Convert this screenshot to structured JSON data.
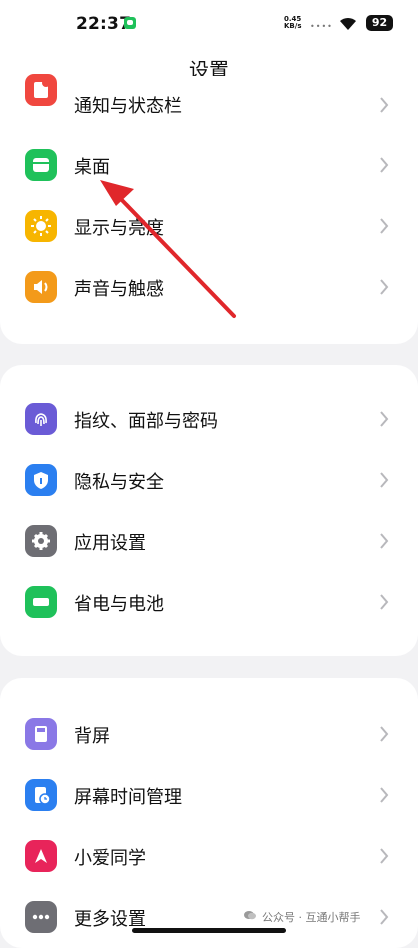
{
  "status_bar": {
    "time": "22:37",
    "speed_value": "0.45",
    "speed_unit": "KB/s",
    "battery": "92"
  },
  "header": {
    "title": "设置"
  },
  "sections": [
    {
      "items": [
        {
          "label": "通知与状态栏",
          "icon": "notification-icon",
          "color": "#f0473f"
        },
        {
          "label": "桌面",
          "icon": "desktop-icon",
          "color": "#1fc15a"
        },
        {
          "label": "显示与亮度",
          "icon": "sun-icon",
          "color": "#f7b500"
        },
        {
          "label": "声音与触感",
          "icon": "speaker-icon",
          "color": "#f39a1a"
        }
      ]
    },
    {
      "items": [
        {
          "label": "指纹、面部与密码",
          "icon": "fingerprint-icon",
          "color": "#6a5bd6"
        },
        {
          "label": "隐私与安全",
          "icon": "shield-icon",
          "color": "#2b7ff0"
        },
        {
          "label": "应用设置",
          "icon": "gear-icon",
          "color": "#6e6e74"
        },
        {
          "label": "省电与电池",
          "icon": "battery-icon",
          "color": "#1fc15a"
        }
      ]
    },
    {
      "items": [
        {
          "label": "背屏",
          "icon": "back-screen-icon",
          "color": "#8a78e6"
        },
        {
          "label": "屏幕时间管理",
          "icon": "screen-time-icon",
          "color": "#2b7ff0"
        },
        {
          "label": "小爱同学",
          "icon": "xiaoai-icon",
          "color": "#e8245a"
        },
        {
          "label": "更多设置",
          "icon": "more-icon",
          "color": "#6e6e74"
        }
      ]
    }
  ],
  "watermark": "公众号 · 互通小帮手",
  "colors": {
    "arrow": "#e0272b",
    "chevron": "#b8b8bc"
  }
}
